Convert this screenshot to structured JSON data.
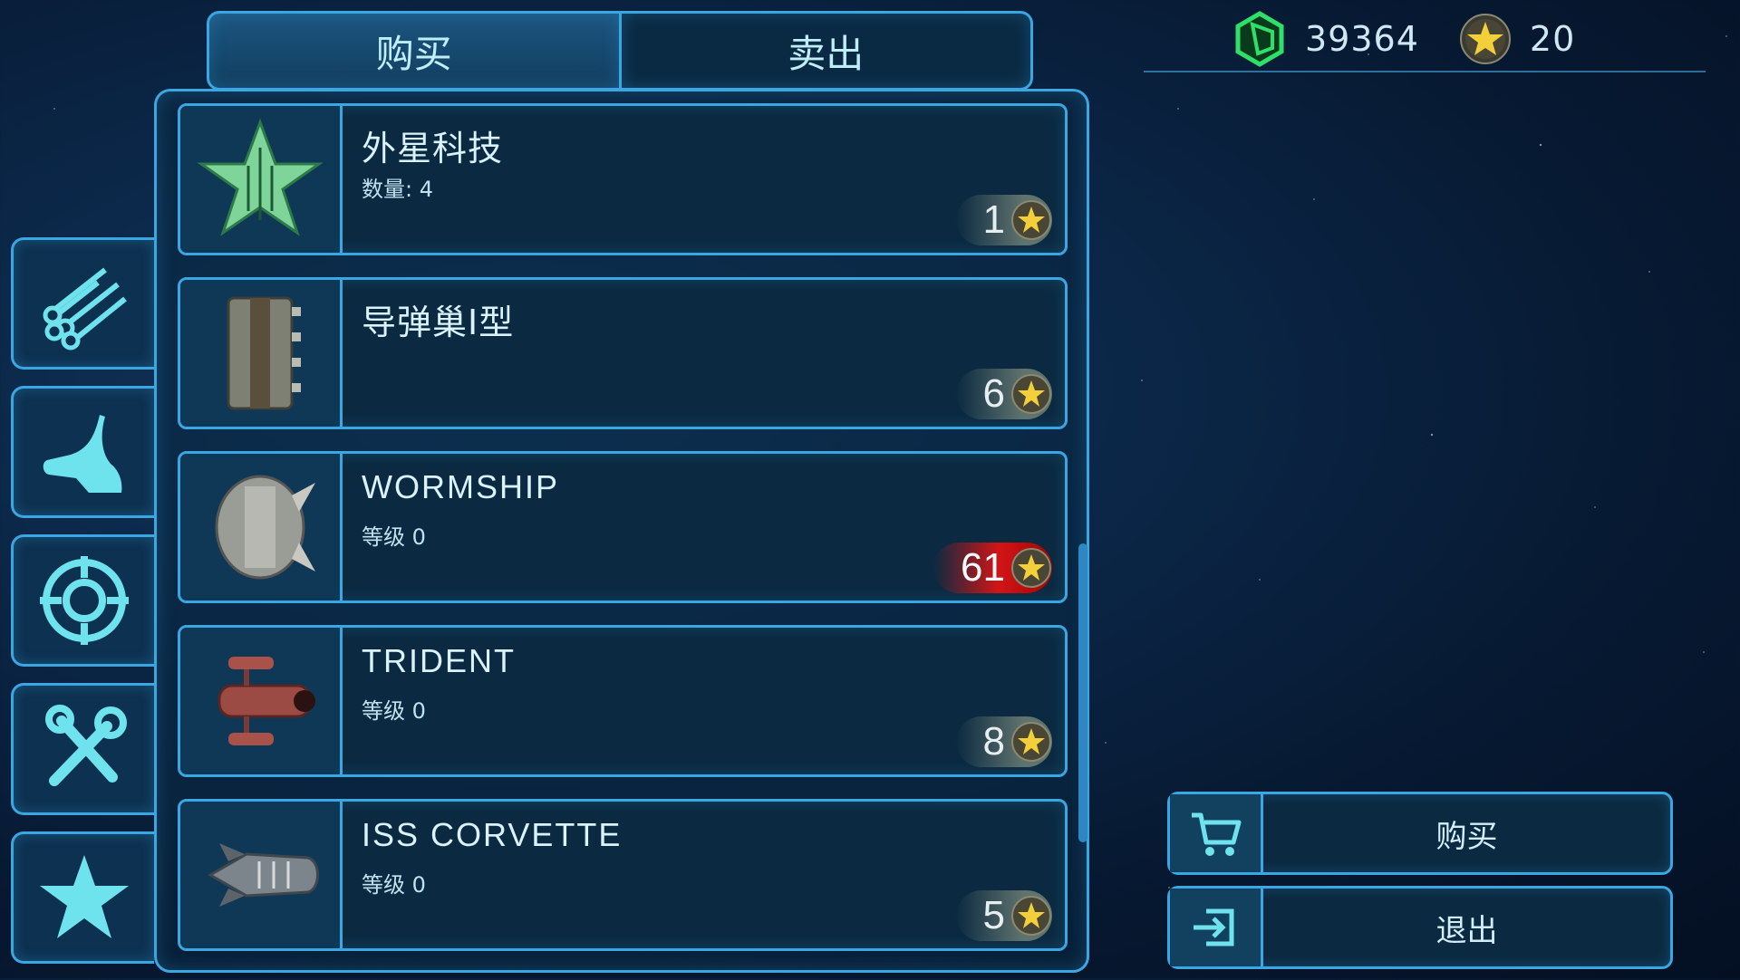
{
  "tabs": [
    {
      "label": "购买",
      "active": true
    },
    {
      "label": "卖出",
      "active": false
    }
  ],
  "currency": {
    "gems": "39364",
    "stars": "20",
    "gem_icon": "green-hex-gem-icon",
    "star_icon": "gold-star-coin-icon"
  },
  "sidebar": {
    "items": [
      {
        "icon": "pipes-icon"
      },
      {
        "icon": "boot-icon"
      },
      {
        "icon": "target-icon"
      },
      {
        "icon": "tools-icon"
      },
      {
        "icon": "star-icon"
      }
    ]
  },
  "shop": {
    "items": [
      {
        "name": "外星科技",
        "sub": "数量: 4",
        "price": "1",
        "affordable": true,
        "icon": "alien-tech-star-icon"
      },
      {
        "name": "导弹巢I型",
        "sub": "",
        "price": "6",
        "affordable": true,
        "icon": "missile-pod-icon"
      },
      {
        "name": "WORMSHIP",
        "sub": "等级 0",
        "price": "61",
        "affordable": false,
        "icon": "wormship-icon"
      },
      {
        "name": "TRIDENT",
        "sub": "等级 0",
        "price": "8",
        "affordable": true,
        "icon": "trident-ship-icon"
      },
      {
        "name": "ISS CORVETTE",
        "sub": "等级 0",
        "price": "5",
        "affordable": true,
        "icon": "corvette-ship-icon"
      }
    ]
  },
  "actions": {
    "buy_label": "购买",
    "exit_label": "退出"
  },
  "colors": {
    "accent": "#3aa6e2",
    "warn": "#d91a1a",
    "gem": "#22c85a",
    "coin": "#e7c44a"
  }
}
